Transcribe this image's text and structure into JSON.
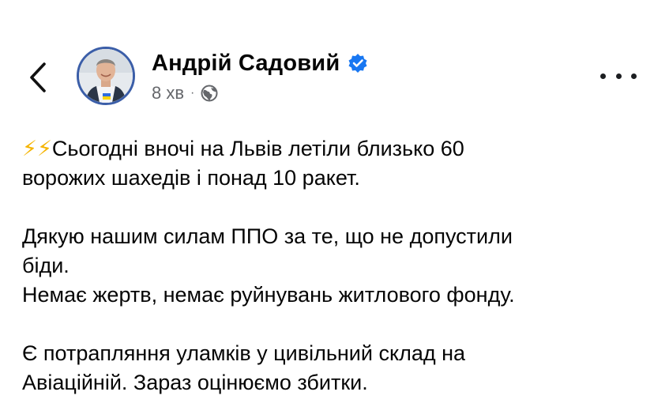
{
  "header": {
    "author_name": "Андрій Садовий",
    "time_ago": "8 хв",
    "separator": "·",
    "icons": [
      "back-chevron-icon",
      "verified-badge-icon",
      "globe-icon",
      "more-options-icon"
    ],
    "colors": {
      "verified": "#1877f2",
      "meta_text": "#65676b",
      "avatar_ring": "#3b5ea8"
    }
  },
  "post": {
    "paragraph1": {
      "emoji": "⚡⚡",
      "line1": "Сьогодні вночі на Львів летіли близько 60",
      "line2": "ворожих шахедів  і понад 10 ракет."
    },
    "paragraph2": {
      "line1": "Дякую нашим силам ППО за те, що не допустили",
      "line2": "біди.",
      "line3": "Немає жертв, немає руйнувань житлового фонду."
    },
    "paragraph3": {
      "line1": "Є потрапляння уламків у цивільний склад на",
      "line2": "Авіаційній. Зараз оцінюємо збитки."
    }
  }
}
